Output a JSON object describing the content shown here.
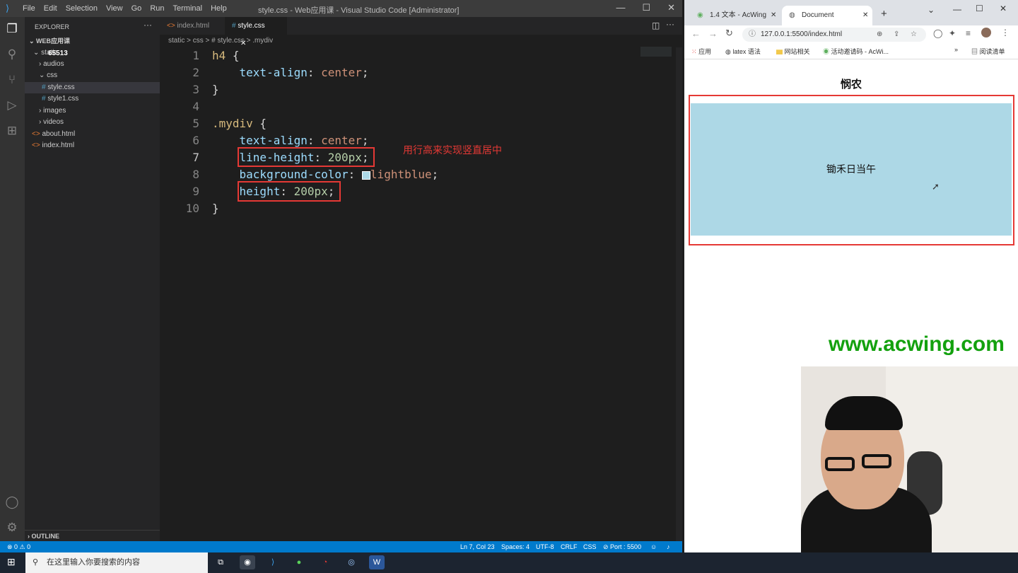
{
  "vscode": {
    "menu": [
      "File",
      "Edit",
      "Selection",
      "View",
      "Go",
      "Run",
      "Terminal",
      "Help"
    ],
    "window_title": "style.css - Web应用课 - Visual Studio Code [Administrator]",
    "explorer_label": "EXPLORER",
    "project": "WEB应用课",
    "tree": [
      {
        "label": "static",
        "type": "folder-open"
      },
      {
        "label": "65513",
        "type": "overlay"
      },
      {
        "label": "audios",
        "type": "folder"
      },
      {
        "label": "css",
        "type": "folder-open"
      },
      {
        "label": "style.css",
        "type": "css"
      },
      {
        "label": "style1.css",
        "type": "css"
      },
      {
        "label": "images",
        "type": "folder"
      },
      {
        "label": "videos",
        "type": "folder"
      },
      {
        "label": "about.html",
        "type": "html"
      },
      {
        "label": "index.html",
        "type": "html"
      }
    ],
    "outline_label": "OUTLINE",
    "tabs": [
      {
        "label": "index.html"
      },
      {
        "label": "style.css"
      }
    ],
    "breadcrumb": "static > css > # style.css > .mydiv",
    "code": {
      "l1": "h4",
      "l1b": " {",
      "l2p": "text-align",
      "l2v": "center",
      "l3": "}",
      "l5": ".mydiv",
      "l5b": " {",
      "l6p": "text-align",
      "l6v": "center",
      "l7p": "line-height",
      "l7n": "200px",
      "l8p": "background-color",
      "l8v": "lightblue",
      "l9p": "height",
      "l9n": "200px",
      "l10": "}"
    },
    "annotation": "用行高来实现竖直居中",
    "status": {
      "left": "⊗ 0 ⚠ 0",
      "ln": "Ln 7, Col 23",
      "spaces": "Spaces: 4",
      "enc": "UTF-8",
      "eol": "CRLF",
      "lang": "CSS",
      "port": "⊘ Port : 5500"
    }
  },
  "browser": {
    "tabs": [
      {
        "label": "1.4 文本 - AcWing"
      },
      {
        "label": "Document"
      }
    ],
    "url": "127.0.0.1:5500/index.html",
    "bookmarks": [
      "应用",
      "latex 语法",
      "网站相关",
      "活动邀请码 - AcWi..."
    ],
    "reading_list": "阅读清单",
    "page": {
      "h4": "悯农",
      "div_text": "锄禾日当午"
    }
  },
  "watermark": "www.acwing.com",
  "taskbar": {
    "search_placeholder": "在这里输入你要搜索的内容"
  },
  "colors": {
    "accent_red": "#e53935",
    "lightblue": "#add8e6",
    "vscode_blue": "#007acc",
    "watermark_green": "#13a10e"
  }
}
